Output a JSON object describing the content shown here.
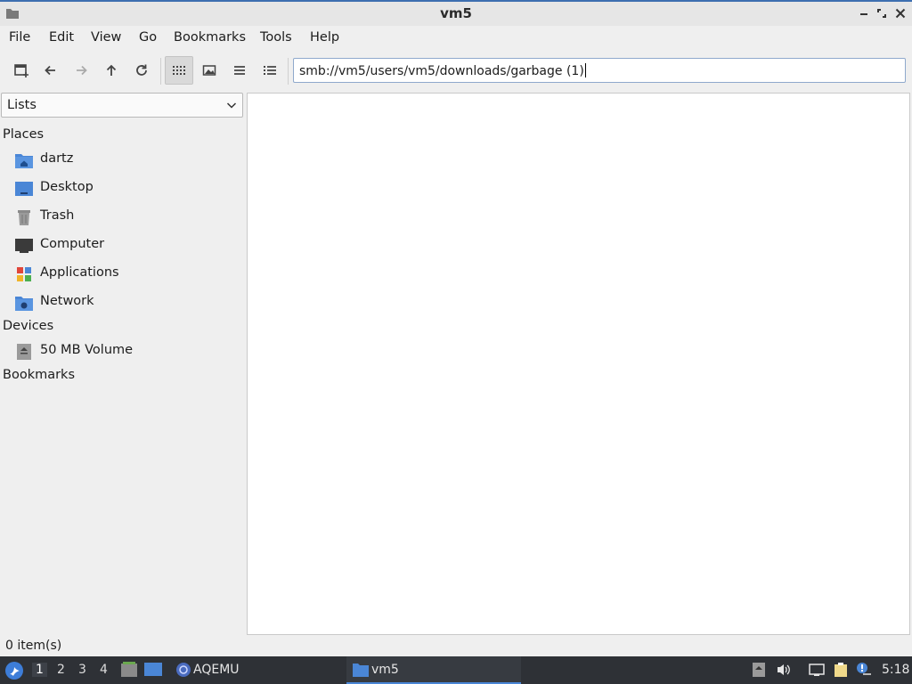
{
  "window": {
    "title": "vm5"
  },
  "menubar": {
    "items": [
      "File",
      "Edit",
      "View",
      "Go",
      "Bookmarks",
      "Tools",
      "Help"
    ]
  },
  "toolbar": {
    "location": "smb://vm5/users/vm5/downloads/garbage (1)",
    "active_view": "icon-view"
  },
  "sidebar": {
    "selector": "Lists",
    "places_heading": "Places",
    "places": [
      "dartz",
      "Desktop",
      "Trash",
      "Computer",
      "Applications",
      "Network"
    ],
    "devices_heading": "Devices",
    "devices": [
      "50 MB Volume"
    ],
    "bookmarks_heading": "Bookmarks"
  },
  "status": {
    "items": "0 item(s)"
  },
  "taskbar": {
    "workspaces": [
      "1",
      "2",
      "3",
      "4"
    ],
    "active_workspace": "1",
    "tasks": [
      "AQEMU",
      "vm5"
    ],
    "clock": "5:18"
  },
  "colors": {
    "accent": "#3d6fb0",
    "folder_blue": "#4a86d6",
    "panel": "#2e3136"
  }
}
